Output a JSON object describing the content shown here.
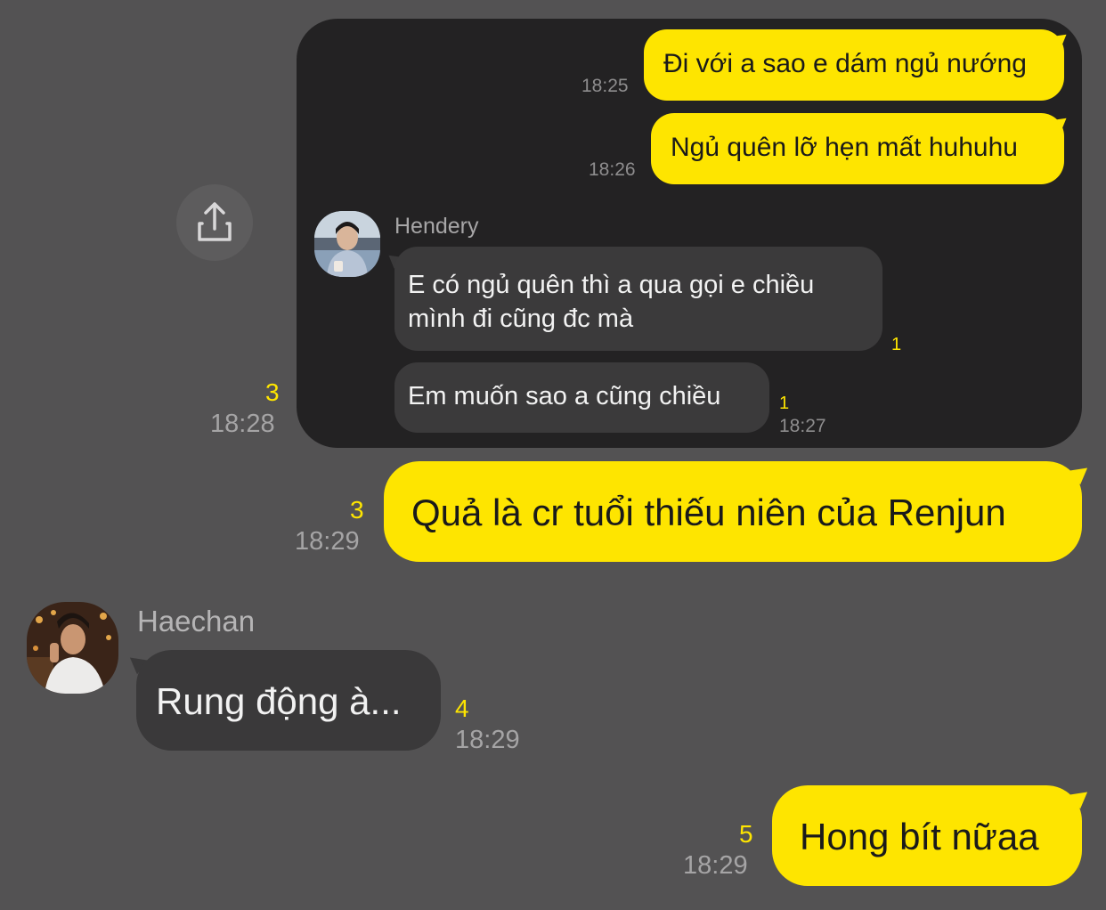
{
  "forwarded": {
    "messages_out": [
      {
        "text": "Đi với a sao e dám ngủ nướng",
        "time": "18:25"
      },
      {
        "text": "Ngủ quên lỡ hẹn mất huhuhu",
        "time": "18:26"
      }
    ],
    "sender_name": "Hendery",
    "messages_in": [
      {
        "line1": "E có ngủ quên thì a qua gọi e chiều",
        "line2": "mình đi cũng đc mà",
        "unread": "1"
      },
      {
        "text": "Em muốn sao a cũng chiều",
        "unread": "1",
        "time": "18:27"
      }
    ],
    "forward_unread": "3",
    "forward_time": "18:28"
  },
  "chat": [
    {
      "type": "out",
      "text": "Quả là cr tuổi thiếu niên của Renjun",
      "unread": "3",
      "time": "18:29"
    },
    {
      "type": "in",
      "sender": "Haechan",
      "text": "Rung động à...",
      "unread": "4",
      "time": "18:29"
    },
    {
      "type": "out",
      "text": "Hong bít nữaa",
      "unread": "5",
      "time": "18:29"
    }
  ],
  "icons": {
    "share": "share-icon"
  },
  "colors": {
    "background": "#535253",
    "card": "#232223",
    "my_bubble": "#fee500",
    "other_bubble": "#3a393a",
    "unread": "#fee500"
  }
}
